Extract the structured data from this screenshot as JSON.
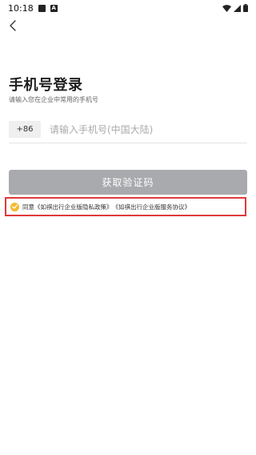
{
  "status_bar": {
    "time": "10:18",
    "left_icons": [
      "image-notification-icon",
      "a-notification-icon"
    ],
    "right_icons": [
      "wifi-icon",
      "signal-icon",
      "battery-icon"
    ]
  },
  "header": {
    "back_icon": "back-arrow-icon",
    "title": "手机号登录",
    "subtitle": "请输入您在企业中常用的手机号"
  },
  "phone": {
    "country_code": "+86",
    "placeholder": "请输入手机号(中国大陆)",
    "value": ""
  },
  "code_button": {
    "label": "获取验证码",
    "bg_color": "#a9aaad"
  },
  "agreement": {
    "checked": true,
    "check_color": "#f5b92d",
    "highlight_color": "#e03a3a",
    "prefix": "同意",
    "privacy_policy": "《如祺出行企业版隐私政策》",
    "service_agreement": "《如祺出行企业版服务协议》"
  }
}
